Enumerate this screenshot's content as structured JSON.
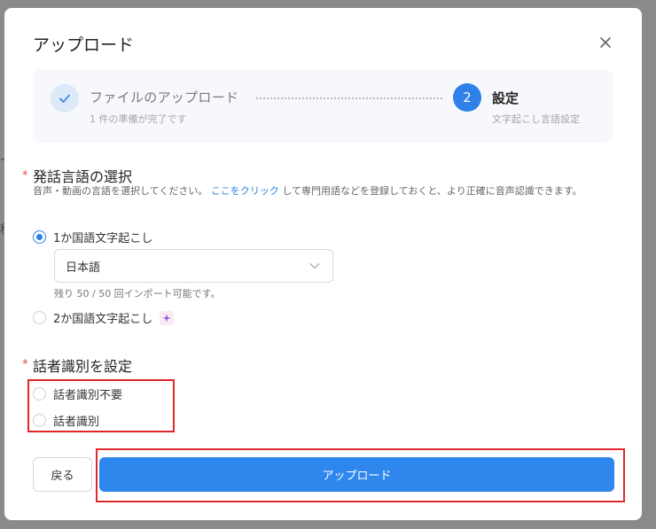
{
  "background_edge_glyphs": [
    "ー",
    "移"
  ],
  "dialog": {
    "title": "アップロード",
    "close_icon": "close-icon"
  },
  "steps": [
    {
      "indicator_icon": "check-icon",
      "title": "ファイルのアップロード",
      "subtitle": "1 件の準備が完了です",
      "state": "done"
    },
    {
      "number": "2",
      "title": "設定",
      "subtitle": "文字起こし言語設定",
      "state": "active"
    }
  ],
  "language_section": {
    "required_mark": "*",
    "title": "発話言語の選択",
    "description_before": "音声・動画の言語を選択してください。",
    "description_link": "ここをクリック",
    "description_after": "して専門用語などを登録しておくと、より正確に音声認識できます。",
    "options": [
      {
        "label": "1か国語文字起こし",
        "checked": true
      },
      {
        "label": "2か国語文字起こし",
        "checked": false,
        "badge_icon": "sparkle-icon"
      }
    ],
    "language_select": {
      "value": "日本語"
    },
    "import_note": "残り 50 / 50 回インポート可能です。"
  },
  "speaker_section": {
    "required_mark": "*",
    "title": "話者識別を設定",
    "options": [
      {
        "label": "話者識別不要",
        "checked": false
      },
      {
        "label": "話者識別",
        "checked": false
      }
    ]
  },
  "footer": {
    "back_label": "戻る",
    "upload_label": "アップロード"
  },
  "colors": {
    "accent": "#2f80e8",
    "highlight_box": "#e0282b",
    "required": "#e0494a"
  }
}
